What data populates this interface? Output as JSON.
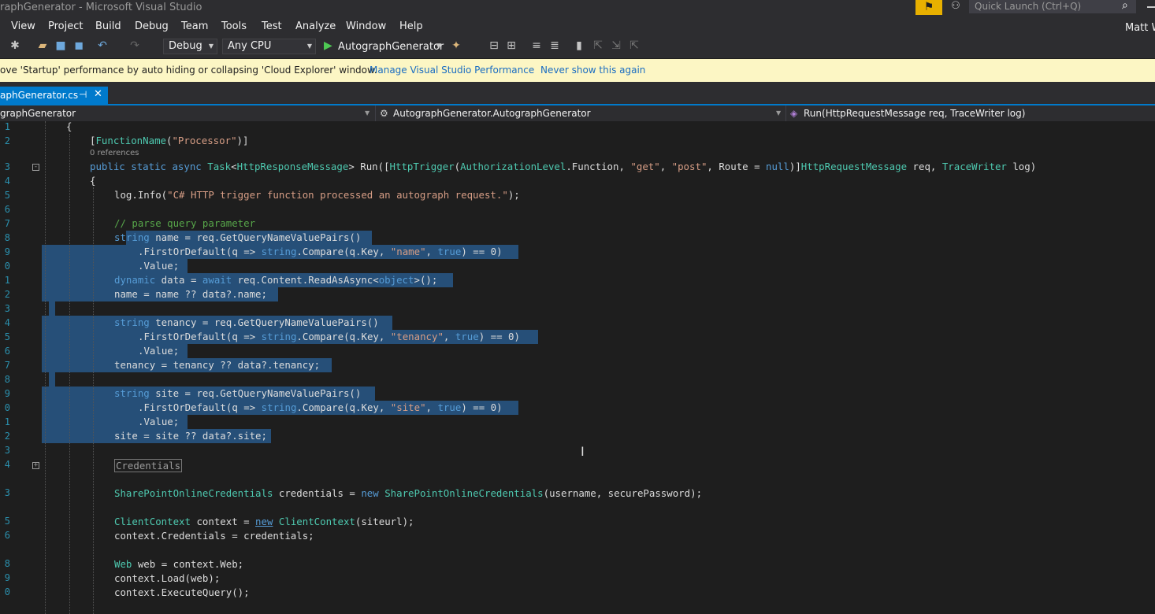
{
  "window": {
    "title": "raphGenerator - Microsoft Visual Studio"
  },
  "titlebar": {
    "quick_launch_placeholder": "Quick Launch (Ctrl+Q)",
    "user": "Matt W"
  },
  "menu": {
    "items": [
      "View",
      "Project",
      "Build",
      "Debug",
      "Team",
      "Tools",
      "Test",
      "Analyze",
      "Window",
      "Help"
    ]
  },
  "toolbar": {
    "configuration": "Debug",
    "platform": "Any CPU",
    "start_label": "AutographGenerator"
  },
  "infobar": {
    "message": "ove 'Startup' performance by auto hiding or collapsing 'Cloud Explorer' window.",
    "link1": "Manage Visual Studio Performance",
    "link2": "Never show this again"
  },
  "tab": {
    "label": "aphGenerator.cs"
  },
  "navbar": {
    "project": "graphGenerator",
    "type": "AutographGenerator.AutographGenerator",
    "member": "Run(HttpRequestMessage req, TraceWriter log)"
  },
  "editor": {
    "line_numbers": [
      "1",
      "2",
      "",
      "3",
      "4",
      "5",
      "6",
      "7",
      "8",
      "9",
      "0",
      "1",
      "2",
      "3",
      "4",
      "5",
      "6",
      "7",
      "8",
      "9",
      "0",
      "1",
      "2",
      "3",
      "4",
      "",
      "3",
      "",
      "5",
      "6",
      "",
      "8",
      "9",
      "0"
    ],
    "codelens": "0 references",
    "region_label": "Credentials"
  },
  "colors": {
    "accent": "#007acc",
    "selection": "#264f78",
    "infobar": "#fcf6c4"
  }
}
